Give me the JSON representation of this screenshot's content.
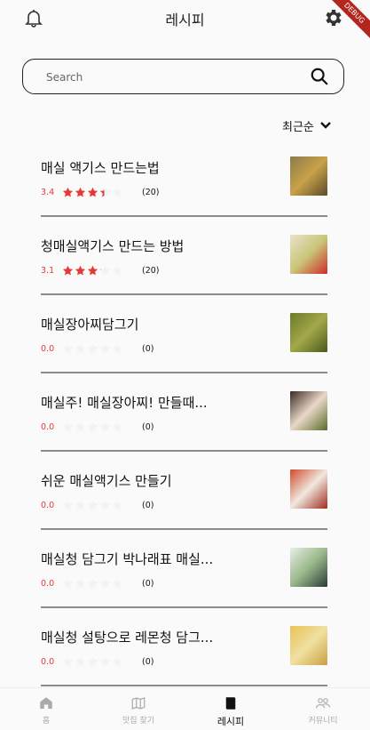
{
  "debug_banner": "DEBUG",
  "header": {
    "title": "레시피",
    "bell_icon": "bell-icon",
    "settings_icon": "gear-icon"
  },
  "search": {
    "placeholder": "Search",
    "value": "",
    "icon": "search-icon"
  },
  "sort": {
    "label": "최근순",
    "icon": "chevron-down-icon"
  },
  "recipes": [
    {
      "name": "매실 액기스 만드는법",
      "rating": "3.4",
      "rating_value": 3.4,
      "count": "(20)",
      "colors": [
        "#8a7a4a",
        "#c9a24a",
        "#5a4a2a"
      ]
    },
    {
      "name": "청매실액기스 만드는 방법",
      "rating": "3.1",
      "rating_value": 3.1,
      "count": "(20)",
      "colors": [
        "#e8e2c8",
        "#c9c77a",
        "#d02a2a"
      ]
    },
    {
      "name": "매실장아찌담그기",
      "rating": "0.0",
      "rating_value": 0,
      "count": "(0)",
      "colors": [
        "#6b7a2a",
        "#a3a84a",
        "#4a5a1a"
      ]
    },
    {
      "name": "매실주! 매실장아찌! 만들때...",
      "rating": "0.0",
      "rating_value": 0,
      "count": "(0)",
      "colors": [
        "#3a2a22",
        "#e8d8c8",
        "#5a6a2a"
      ]
    },
    {
      "name": "쉬운 매실액기스 만들기",
      "rating": "0.0",
      "rating_value": 0,
      "count": "(0)",
      "colors": [
        "#d04a2a",
        "#f0e8e0",
        "#a02a1a"
      ]
    },
    {
      "name": "매실청 담그기 박나래표 매실...",
      "rating": "0.0",
      "rating_value": 0,
      "count": "(0)",
      "colors": [
        "#e8eee8",
        "#9ab88a",
        "#2a3a3a"
      ]
    },
    {
      "name": "매실청 설탕으로 레몬청 담그...",
      "rating": "0.0",
      "rating_value": 0,
      "count": "(0)",
      "colors": [
        "#e8c25a",
        "#f0e0a0",
        "#c8a040"
      ]
    }
  ],
  "bottom_nav": [
    {
      "label": "홈",
      "icon": "home-icon",
      "active": false
    },
    {
      "label": "맛집 찾기",
      "icon": "map-icon",
      "active": false
    },
    {
      "label": "레시피",
      "icon": "book-icon",
      "active": true
    },
    {
      "label": "커뮤니티",
      "icon": "people-icon",
      "active": false
    }
  ],
  "colors": {
    "accent": "#e53935",
    "star_filled": "#e53935",
    "star_empty": "#f2f2f2",
    "divider": "#8a8a8a"
  }
}
